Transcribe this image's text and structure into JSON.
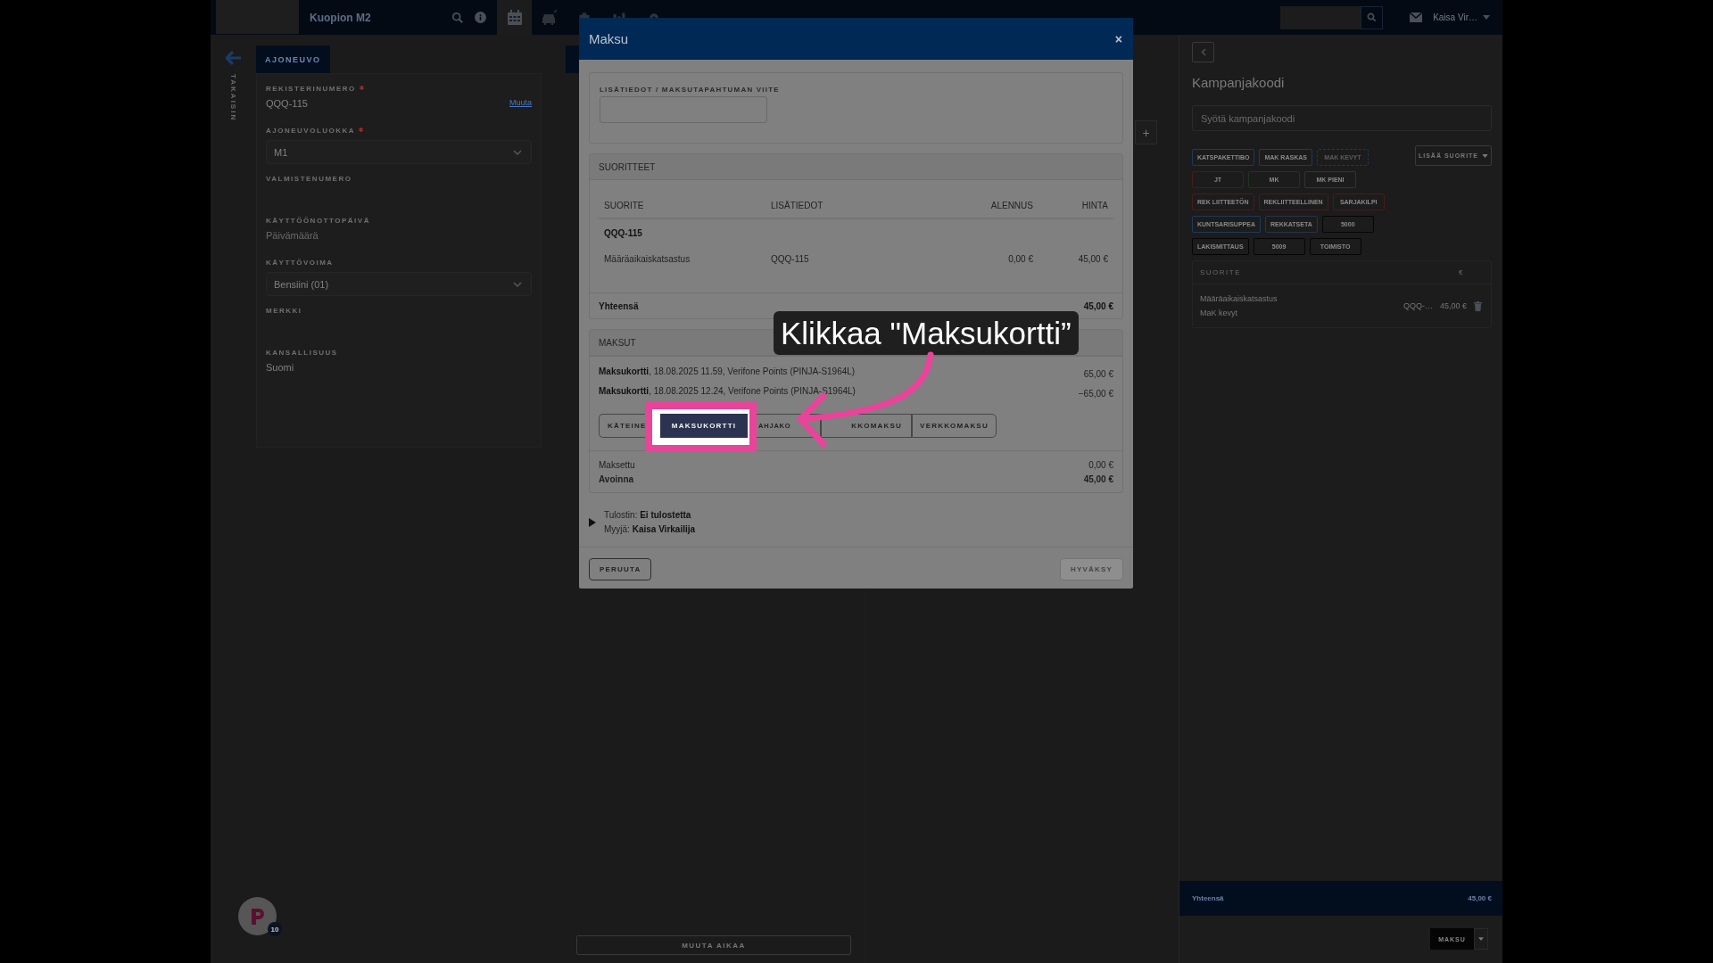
{
  "top_bar": {
    "search_value": "Kuopion M2",
    "nav_tabs": [
      {
        "selected": true
      },
      {
        "selected": false
      },
      {
        "selected": false
      },
      {
        "selected": false
      },
      {
        "selected": false
      }
    ],
    "user_menu": "Kaisa Vir…"
  },
  "sidebar": {
    "back_label": "TAKAISIN"
  },
  "vehicle": {
    "tab": "AJONEUVO",
    "fields": [
      {
        "kind": "text",
        "label": "REKISTERINUMERO",
        "required": true,
        "value": "QQQ-115",
        "action": "Muuta"
      },
      {
        "kind": "select",
        "label": "AJONEUVOLUOKKA",
        "required": true,
        "value": "M1"
      },
      {
        "kind": "text",
        "label": "VALMISTENUMERO",
        "required": false
      },
      {
        "kind": "text",
        "label": "KÄYTTÖÖNOTTOPÄIVÄ",
        "required": false,
        "placeholder": "Päivämäärä"
      },
      {
        "kind": "select",
        "label": "KÄYTTÖVOIMA",
        "required": false,
        "value": "Bensiini (01)"
      },
      {
        "kind": "text",
        "label": "MERKKI",
        "required": false
      },
      {
        "kind": "text",
        "label": "KANSALLISUUS",
        "required": false,
        "value": "Suomi"
      }
    ]
  },
  "middle": {
    "add_button": "+",
    "time_button": "MUUTA AIKAA"
  },
  "notification_badge": "10",
  "right_panel": {
    "title": "Kampanjakoodi",
    "code_placeholder": "Syötä kampanjakoodi",
    "add_service": "LISÄÄ SUORITE",
    "quick_buttons": [
      [
        {
          "label": "KATSPAKETTIBO",
          "color": "#1c3a5e",
          "disabled": false
        },
        {
          "label": "MAK RASKAS",
          "color": "#1c3a5e",
          "disabled": false
        },
        {
          "label": "MAK KEVYT",
          "color": "#1c3a5e",
          "disabled": true
        }
      ],
      [
        {
          "label": "JT",
          "color": "#4c1a1a",
          "disabled": false
        },
        {
          "label": "MK",
          "color": "#1e3520",
          "disabled": false
        },
        {
          "label": "MK PIENI",
          "color": "#333333",
          "disabled": false
        }
      ],
      [
        {
          "label": "REK LIITTEETÖN",
          "color": "#4c1a1a",
          "disabled": false
        },
        {
          "label": "REKLIITTEELLINEN",
          "color": "#4c1a1a",
          "disabled": false
        },
        {
          "label": "SARJAKILPI",
          "color": "#4c1a1a",
          "disabled": false
        }
      ],
      [
        {
          "label": "KUNTSARISUPPEA",
          "color": "#1c3a5e",
          "disabled": false
        },
        {
          "label": "REKKATSETA",
          "color": "#26334a",
          "disabled": false
        },
        {
          "label": "5000",
          "color": "#050505",
          "disabled": false
        }
      ],
      [
        {
          "label": "LAKISMITTAUS",
          "color": "#050505",
          "disabled": false
        },
        {
          "label": "5009",
          "color": "#050505",
          "disabled": false
        },
        {
          "label": "TOIMISTO",
          "color": "#050505",
          "disabled": false
        }
      ]
    ],
    "table": {
      "columns": [
        "SUORITE",
        "€"
      ],
      "rows": [
        {
          "name": "Määräaikaiskatsastus",
          "subtitle": "MaK kevyt",
          "reference": "QQQ-…",
          "price": "45,00 €"
        }
      ]
    },
    "total_label": "Yhteensä",
    "total": "45,00 €",
    "pay_button": "MAKSU"
  },
  "modal": {
    "title": "Maksu",
    "close": "×",
    "reference_label": "LISÄTIEDOT / MAKSUTAPAHTUMAN VIITE",
    "services": {
      "title": "SUORITTEET",
      "columns": [
        "SUORITE",
        "LISÄTIEDOT",
        "ALENNUS",
        "HINTA"
      ],
      "groups": [
        {
          "name": "QQQ-115",
          "rows": [
            {
              "cells": [
                "Määräaikaiskatsastus",
                "QQQ-115",
                "0,00 €",
                "45,00 €"
              ]
            }
          ]
        }
      ],
      "total_label": "Yhteensä",
      "total": "45,00 €"
    },
    "payments": {
      "title": "MAKSUT",
      "entries": [
        {
          "text": "**Maksukortti**, 18.08.2025 11.59, Verifone Points (PINJA-S1964L)",
          "amount": "65,00 €"
        },
        {
          "text": "**Maksukortti**, 18.08.2025 12.24, Verifone Points (PINJA-S1964L)",
          "amount": "−65,00 €"
        }
      ],
      "methods": [
        {
          "label": "KÄTEINE",
          "highlighted": false
        },
        {
          "label": "MAKSUKORTTI",
          "highlighted": true
        },
        {
          "label": "AHJAKO",
          "highlighted": false
        },
        {
          "label": "KKOMAKSU",
          "highlighted": false
        },
        {
          "label": "VERKKOMAKSU",
          "highlighted": false
        }
      ],
      "paid_label": "Maksettu",
      "paid": "0,00 €",
      "open_label": "Avoinna",
      "open": "45,00 €"
    },
    "details": {
      "expanded": false,
      "lines": [
        "Tulostin: **Ei tulostetta**",
        "Myyjä: **Kaisa Virkailija**"
      ]
    },
    "cancel": "PERUUTA",
    "accept": {
      "label": "HYVÄKSY",
      "disabled": true
    }
  },
  "callout": {
    "text": "Klikkaa \"Maksukortti”"
  }
}
